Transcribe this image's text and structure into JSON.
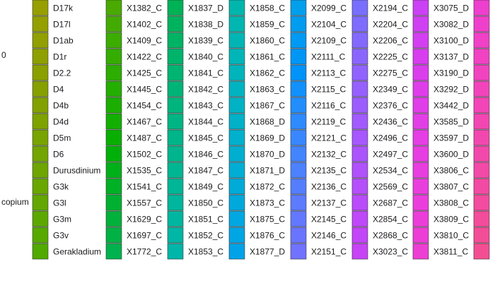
{
  "chart_data": {
    "type": "legend",
    "left_edge_fragments": [
      "0",
      "copium"
    ],
    "columns": [
      {
        "items": [
          {
            "label": "D17k",
            "color": "#979f00"
          },
          {
            "label": "D17l",
            "color": "#949f00"
          },
          {
            "label": "D1ab",
            "color": "#919f00"
          },
          {
            "label": "D1r",
            "color": "#8e9f00"
          },
          {
            "label": "D2.2",
            "color": "#8aa000"
          },
          {
            "label": "D4",
            "color": "#86a000"
          },
          {
            "label": "D4b",
            "color": "#82a100"
          },
          {
            "label": "D4d",
            "color": "#7ea200"
          },
          {
            "label": "D5m",
            "color": "#79a300"
          },
          {
            "label": "D6",
            "color": "#74a400"
          },
          {
            "label": "Durusdinium",
            "color": "#6fa500"
          },
          {
            "label": "G3k",
            "color": "#69a600"
          },
          {
            "label": "G3l",
            "color": "#63a700"
          },
          {
            "label": "G3m",
            "color": "#5da800"
          },
          {
            "label": "G3v",
            "color": "#57a900"
          },
          {
            "label": "Gerakladium",
            "color": "#51aa00"
          }
        ]
      },
      {
        "items": [
          {
            "label": "X1382_C",
            "color": "#4aaa00"
          },
          {
            "label": "X1402_C",
            "color": "#43ab00"
          },
          {
            "label": "X1409_C",
            "color": "#3cac00"
          },
          {
            "label": "X1422_C",
            "color": "#34ad00"
          },
          {
            "label": "X1425_C",
            "color": "#2cad00"
          },
          {
            "label": "X1445_C",
            "color": "#24ae00"
          },
          {
            "label": "X1454_C",
            "color": "#1bae00"
          },
          {
            "label": "X1467_C",
            "color": "#12af00"
          },
          {
            "label": "X1487_C",
            "color": "#09af00"
          },
          {
            "label": "X1502_C",
            "color": "#00b009"
          },
          {
            "label": "X1535_C",
            "color": "#00b018"
          },
          {
            "label": "X1541_C",
            "color": "#00b025"
          },
          {
            "label": "X1557_C",
            "color": "#00b131"
          },
          {
            "label": "X1629_C",
            "color": "#00b13b"
          },
          {
            "label": "X1697_C",
            "color": "#00b145"
          },
          {
            "label": "X1772_C",
            "color": "#00b24e"
          }
        ]
      },
      {
        "items": [
          {
            "label": "X1837_D",
            "color": "#00b256"
          },
          {
            "label": "X1838_D",
            "color": "#00b25d"
          },
          {
            "label": "X1839_C",
            "color": "#00b364"
          },
          {
            "label": "X1840_C",
            "color": "#00b36b"
          },
          {
            "label": "X1841_C",
            "color": "#00b471"
          },
          {
            "label": "X1842_C",
            "color": "#00b477"
          },
          {
            "label": "X1843_C",
            "color": "#00b47d"
          },
          {
            "label": "X1844_C",
            "color": "#00b583"
          },
          {
            "label": "X1845_C",
            "color": "#00b588"
          },
          {
            "label": "X1846_C",
            "color": "#00b58d"
          },
          {
            "label": "X1847_C",
            "color": "#00b692"
          },
          {
            "label": "X1849_C",
            "color": "#00b697"
          },
          {
            "label": "X1850_C",
            "color": "#00b69c"
          },
          {
            "label": "X1851_C",
            "color": "#00b6a0"
          },
          {
            "label": "X1852_C",
            "color": "#00b6a4"
          },
          {
            "label": "X1853_C",
            "color": "#00b6a8"
          }
        ]
      },
      {
        "items": [
          {
            "label": "X1858_C",
            "color": "#00b6ac"
          },
          {
            "label": "X1859_C",
            "color": "#00b6b0"
          },
          {
            "label": "X1860_C",
            "color": "#00b5b4"
          },
          {
            "label": "X1861_C",
            "color": "#00b5b8"
          },
          {
            "label": "X1862_C",
            "color": "#00b4bc"
          },
          {
            "label": "X1863_C",
            "color": "#00b3c0"
          },
          {
            "label": "X1867_C",
            "color": "#00b2c4"
          },
          {
            "label": "X1868_D",
            "color": "#00b1c8"
          },
          {
            "label": "X1869_D",
            "color": "#00b0cc"
          },
          {
            "label": "X1870_D",
            "color": "#00aed0"
          },
          {
            "label": "X1871_D",
            "color": "#00add4"
          },
          {
            "label": "X1872_C",
            "color": "#00abd8"
          },
          {
            "label": "X1873_C",
            "color": "#00a9dc"
          },
          {
            "label": "X1875_C",
            "color": "#00a7e0"
          },
          {
            "label": "X1876_C",
            "color": "#00a5e4"
          },
          {
            "label": "X1877_D",
            "color": "#00a2e8"
          }
        ]
      },
      {
        "items": [
          {
            "label": "X2099_C",
            "color": "#009fec"
          },
          {
            "label": "X2104_C",
            "color": "#009cf0"
          },
          {
            "label": "X2109_C",
            "color": "#0099f3"
          },
          {
            "label": "X2111_C",
            "color": "#0096f6"
          },
          {
            "label": "X2113_C",
            "color": "#0093f9"
          },
          {
            "label": "X2115_C",
            "color": "#1290fb"
          },
          {
            "label": "X2116_C",
            "color": "#228dfd"
          },
          {
            "label": "X2119_C",
            "color": "#2e8aff"
          },
          {
            "label": "X2121_C",
            "color": "#3987ff"
          },
          {
            "label": "X2132_C",
            "color": "#4384ff"
          },
          {
            "label": "X2135_C",
            "color": "#4c81ff"
          },
          {
            "label": "X2136_C",
            "color": "#547eff"
          },
          {
            "label": "X2137_C",
            "color": "#5c7bff"
          },
          {
            "label": "X2145_C",
            "color": "#6378ff"
          },
          {
            "label": "X2146_C",
            "color": "#6a75ff"
          },
          {
            "label": "X2151_C",
            "color": "#7172ff"
          }
        ]
      },
      {
        "items": [
          {
            "label": "X2194_C",
            "color": "#786fff"
          },
          {
            "label": "X2204_C",
            "color": "#7e6cff"
          },
          {
            "label": "X2206_C",
            "color": "#8469ff"
          },
          {
            "label": "X2225_C",
            "color": "#8a66ff"
          },
          {
            "label": "X2275_C",
            "color": "#9063ff"
          },
          {
            "label": "X2349_C",
            "color": "#9660ff"
          },
          {
            "label": "X2376_C",
            "color": "#9c5dff"
          },
          {
            "label": "X2436_C",
            "color": "#a15aff"
          },
          {
            "label": "X2496_C",
            "color": "#a657fe"
          },
          {
            "label": "X2497_C",
            "color": "#ab54fd"
          },
          {
            "label": "X2534_C",
            "color": "#b051fc"
          },
          {
            "label": "X2569_C",
            "color": "#b54efb"
          },
          {
            "label": "X2687_C",
            "color": "#ba4bfa"
          },
          {
            "label": "X2854_C",
            "color": "#bf48f9"
          },
          {
            "label": "X2868_C",
            "color": "#c345f8"
          },
          {
            "label": "X3023_C",
            "color": "#c743f6"
          }
        ]
      },
      {
        "items": [
          {
            "label": "X3075_D",
            "color": "#cb41f4"
          },
          {
            "label": "X3082_D",
            "color": "#cf40f2"
          },
          {
            "label": "X3100_D",
            "color": "#d33ff0"
          },
          {
            "label": "X3137_D",
            "color": "#d73eee"
          },
          {
            "label": "X3190_D",
            "color": "#da3eec"
          },
          {
            "label": "X3292_D",
            "color": "#dd3eea"
          },
          {
            "label": "X3442_D",
            "color": "#e03ee8"
          },
          {
            "label": "X3585_D",
            "color": "#e23ee6"
          },
          {
            "label": "X3597_D",
            "color": "#e43ee4"
          },
          {
            "label": "X3600_D",
            "color": "#e63ee2"
          },
          {
            "label": "X3806_C",
            "color": "#e83ee0"
          },
          {
            "label": "X3807_C",
            "color": "#e93ede"
          },
          {
            "label": "X3808_C",
            "color": "#ea3edc"
          },
          {
            "label": "X3809_C",
            "color": "#eb3ed9"
          },
          {
            "label": "X3810_C",
            "color": "#ec3ed6"
          },
          {
            "label": "X3811_C",
            "color": "#ed3ed3"
          }
        ]
      },
      {
        "items": [
          {
            "label": "",
            "color": "#ee3fcf"
          },
          {
            "label": "",
            "color": "#ef40cb"
          },
          {
            "label": "",
            "color": "#f041c7"
          },
          {
            "label": "",
            "color": "#f042c3"
          },
          {
            "label": "",
            "color": "#f143bf"
          },
          {
            "label": "",
            "color": "#f144bb"
          },
          {
            "label": "",
            "color": "#f245b7"
          },
          {
            "label": "",
            "color": "#f246b3"
          },
          {
            "label": "",
            "color": "#f247af"
          },
          {
            "label": "",
            "color": "#f348ab"
          },
          {
            "label": "",
            "color": "#f349a7"
          },
          {
            "label": "",
            "color": "#f34aa3"
          },
          {
            "label": "",
            "color": "#f34b9f"
          },
          {
            "label": "",
            "color": "#f34c9b"
          },
          {
            "label": "",
            "color": "#f34d97"
          },
          {
            "label": "",
            "color": "#f34e93"
          }
        ]
      }
    ]
  }
}
